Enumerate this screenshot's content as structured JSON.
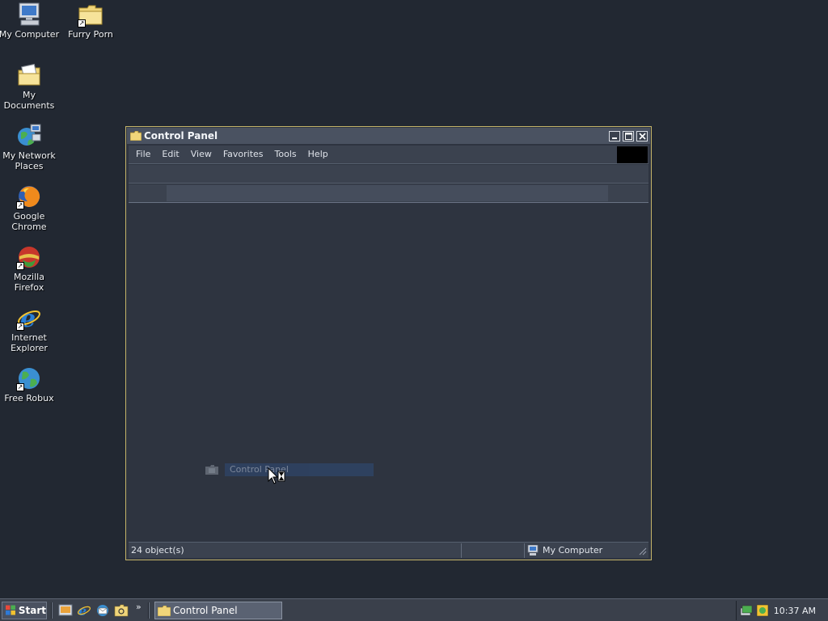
{
  "desktop": {
    "icons": [
      {
        "label": "My Computer"
      },
      {
        "label": "Furry Porn"
      },
      {
        "label": "My Documents"
      },
      {
        "label": "My Network Places"
      },
      {
        "label": "Google Chrome"
      },
      {
        "label": "Mozilla Firefox"
      },
      {
        "label": "Internet Explorer"
      },
      {
        "label": "Free Robux"
      }
    ]
  },
  "window": {
    "title": "Control Panel",
    "menu": [
      "File",
      "Edit",
      "View",
      "Favorites",
      "Tools",
      "Help"
    ],
    "drag_label": "Control Panel",
    "status": {
      "objects": "24 object(s)",
      "zone": "My Computer"
    }
  },
  "taskbar": {
    "start_label": "Start",
    "more": "»",
    "task_label": "Control Panel",
    "clock": "10:37 AM"
  },
  "colors": {
    "desktop_bg": "#222832",
    "window_border": "#c4b468",
    "titlebar": "#4a5261",
    "highlight": "#2f4569"
  }
}
